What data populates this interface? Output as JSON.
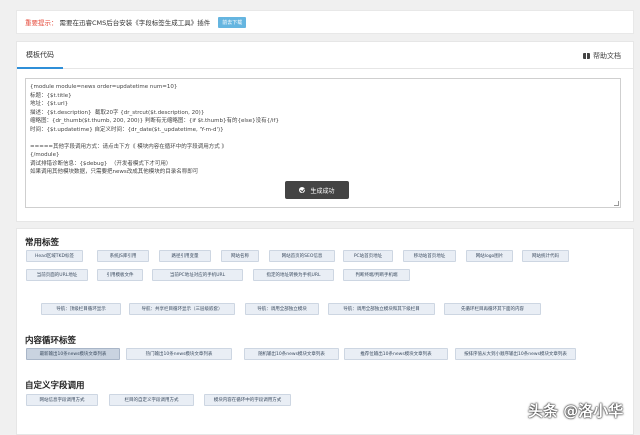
{
  "notice": {
    "warn": "重要提示：",
    "text": "需要在迅睿CMS后台安装《字段标签生成工具》插件",
    "download_label": "前去下载"
  },
  "panel": {
    "tab_label": "模板代码",
    "help_label": "帮助文档",
    "help_icon": "book-icon",
    "code_lines": [
      "{module module=news order=updatetime num=10}",
      "标题：{$t.title}",
      "地址：{$t.url}",
      "描述：{$t.description}  截取20字 {dr_strcut($t.description, 20)}",
      "缩略图：{dr_thumb($t.thumb, 200, 200)} 判断有无缩略图：{if $t.thumb}有的{else}没有{/if}",
      "时间：{$t.updatetime} 自定义时间：{dr_date($t._updatetime, 'Y-m-d')}",
      "",
      "=====其他字段调用方式：请点击下方《 模块内容在循环中的字段调用方式 》",
      "{/module}",
      "调试排错诊断信息：{$debug}  （开发者模式下才可用）",
      "如果调用其他模块数据，只需要把news改成其他模块的目录名称即可"
    ],
    "generate_label": "生成成功",
    "generate_icon": "check-circle-icon"
  },
  "sections": {
    "common": {
      "title": "常用标签",
      "row1": [
        "Head区域TKD标签",
        "系统JS库引用",
        "路径引用变量",
        "网站名称",
        "网站首页的SEO信息",
        "PC站首页地址",
        "移动站首页地址",
        "网站logo图片",
        "网站统计代码"
      ],
      "row2": [
        "当前页面的URL地址",
        "引用模板文件",
        "当前PC地址对应的手机URL",
        "指定的地址转换为手机URL",
        "判断终端/判断手机端"
      ],
      "row3": [
        "导航：顶级栏目循环显示",
        "导航：共享栏目循环显示（三层级嵌套）",
        "导航：调用全部独立模块",
        "导航：调用全部独立模块和其下级栏目",
        "先循环栏目再循环其下面的内容"
      ]
    },
    "content": {
      "title": "内容循环标签",
      "row1": [
        "最新输出10条news模块文章列表",
        "热门输出10条news模块文章列表",
        "随机输出10条news模块文章列表",
        "推荐位输出10条news模块文章列表",
        "按排序值从大到小顺序输出10条news模块文章列表"
      ]
    },
    "custom": {
      "title": "自定义字段调用",
      "row1": [
        "网站信息字段调用方式",
        "栏目的自定义字段调用方式",
        "模块内容在循环中的字段调用方式"
      ]
    }
  },
  "watermark": "头条 @洛小华"
}
